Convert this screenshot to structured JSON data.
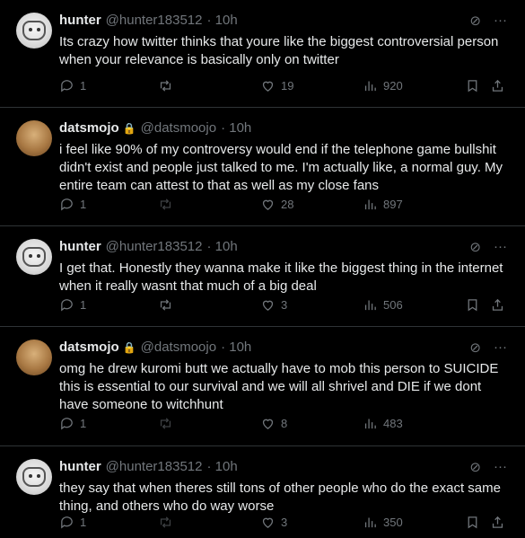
{
  "tweets": [
    {
      "name": "hunter",
      "handle": "@hunter183512",
      "time": "· 10h",
      "text": "Its crazy how twitter thinks that youre like the biggest controversial person when your relevance is basically only on twitter",
      "replies": "1",
      "likes": "19",
      "views": "920"
    },
    {
      "name": "datsmojo",
      "handle": "@datsmoojo",
      "time": "· 10h",
      "text": "i feel like 90% of my controversy would end if the telephone game bullshit didn't exist and people just talked to me. I'm actually like, a normal guy. My entire team can attest to that as well as my close fans",
      "replies": "1",
      "likes": "28",
      "views": "897"
    },
    {
      "name": "hunter",
      "handle": "@hunter183512",
      "time": "· 10h",
      "text": "I get that. Honestly they wanna make it like the biggest thing in the internet when it really wasnt that much of a big deal",
      "replies": "1",
      "likes": "3",
      "views": "506"
    },
    {
      "name": "datsmojo",
      "handle": "@datsmoojo",
      "time": "· 10h",
      "text": "omg he drew kuromi butt we actually have to mob this person to SUICIDE this is essential to our survival and we will all shrivel and DIE if we dont have someone to witchhunt",
      "replies": "1",
      "likes": "8",
      "views": "483"
    },
    {
      "name": "hunter",
      "handle": "@hunter183512",
      "time": "· 10h",
      "text": "they say that when theres still tons of other people who do the exact same thing, and others who do way worse",
      "replies": "1",
      "likes": "3",
      "views": "350"
    }
  ],
  "icons": {
    "more": "more-horizontal-icon",
    "grok": "grok-icon",
    "reply": "reply-icon",
    "retweet": "retweet-icon",
    "like": "heart-icon",
    "views": "views-icon",
    "bookmark": "bookmark-icon",
    "share": "share-icon",
    "lock": "lock-icon"
  },
  "colors": {
    "background": "#000000",
    "text": "#e7e9ea",
    "muted": "#71767b",
    "divider": "#2f3336"
  }
}
